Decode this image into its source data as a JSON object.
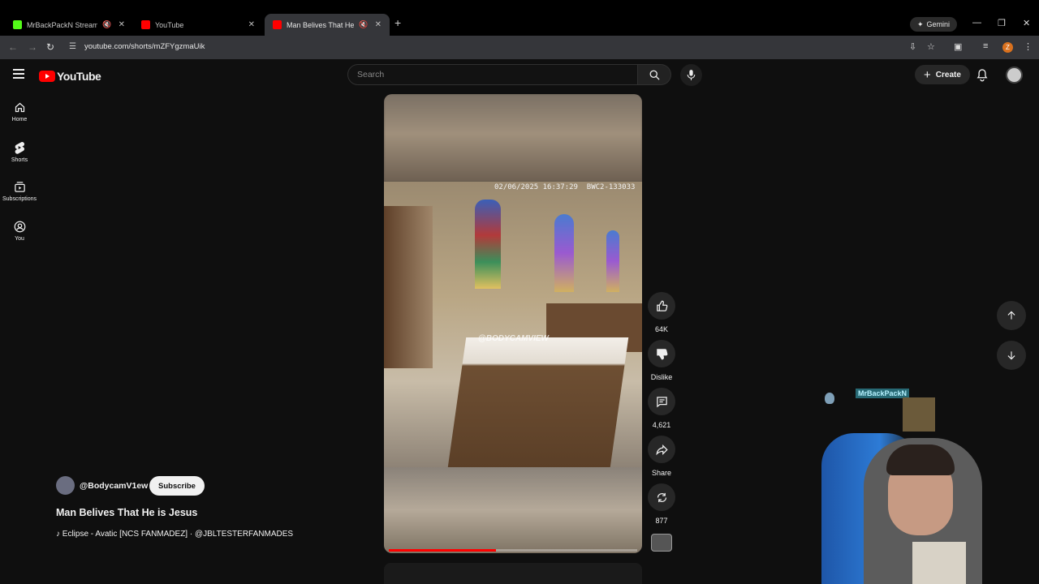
{
  "browser": {
    "tabs": [
      {
        "title": "MrBackPackN Stream - Wa",
        "favicon_color": "#53fc18",
        "muted": true,
        "active": false
      },
      {
        "title": "YouTube",
        "favicon_color": "#ff0000",
        "muted": false,
        "active": false
      },
      {
        "title": "Man Belives That He is Jesu",
        "favicon_color": "#ff0000",
        "muted": true,
        "active": true
      }
    ],
    "gemini_label": "Gemini",
    "url": "youtube.com/shorts/mZFYgzmaUik",
    "profile_initial": "Z"
  },
  "youtube": {
    "logo_text": "YouTube",
    "search_placeholder": "Search",
    "create_label": "Create",
    "sidebar": [
      {
        "label": "Home",
        "icon": "home-icon"
      },
      {
        "label": "Shorts",
        "icon": "shorts-icon"
      },
      {
        "label": "Subscriptions",
        "icon": "subscriptions-icon"
      },
      {
        "label": "You",
        "icon": "you-icon"
      }
    ],
    "video": {
      "timestamp": "02/06/2025 16:37:29",
      "camera_id": "BWC2-133033",
      "watermark": "@BODYCAMVIEW",
      "progress": 0.43
    },
    "actions": [
      {
        "name": "like",
        "label": "64K"
      },
      {
        "name": "dislike",
        "label": "Dislike"
      },
      {
        "name": "comments",
        "label": "4,621"
      },
      {
        "name": "share",
        "label": "Share"
      },
      {
        "name": "remix",
        "label": "877"
      }
    ],
    "meta": {
      "channel": "@BodycamV1ew",
      "subscribe": "Subscribe",
      "title": "Man Belives That He is Jesus",
      "song": "♪ Eclipse - Avatic [NCS FANMADEZ] · @JBLTESTERFANMADES"
    }
  },
  "webcam": {
    "overlay_tag": "MrBackPackN"
  },
  "colors": {
    "accent": "#ff0000",
    "background": "#0f0f0f"
  }
}
